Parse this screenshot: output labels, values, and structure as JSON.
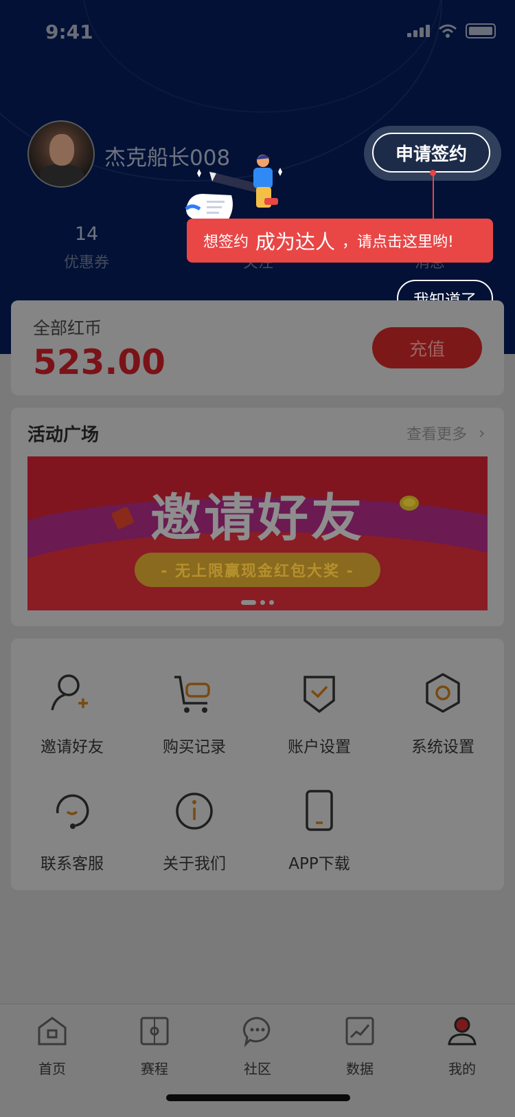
{
  "status_bar": {
    "time": "9:41"
  },
  "profile": {
    "username": "杰克船长008",
    "apply_button": "申请签约"
  },
  "stats": [
    {
      "value": "14",
      "label": "优惠券"
    },
    {
      "value": "",
      "label": "关注"
    },
    {
      "value": "",
      "label": "消息"
    }
  ],
  "tooltip": {
    "prefix": "想签约",
    "highlight": "成为达人",
    "comma": "，",
    "suffix": "请点击这里哟!",
    "dismiss_button": "我知道了"
  },
  "wallet": {
    "title": "全部红币",
    "amount": "523.00",
    "recharge_button": "充值"
  },
  "activity": {
    "title": "活动广场",
    "see_more": "查看更多",
    "banner": {
      "title": "邀请好友",
      "subtitle": "- 无上限赢现金红包大奖 -",
      "dots": 3,
      "active_dot": 0
    }
  },
  "menu": [
    {
      "label": "邀请好友",
      "icon": "invite-friend-icon"
    },
    {
      "label": "购买记录",
      "icon": "cart-icon"
    },
    {
      "label": "账户设置",
      "icon": "shield-check-icon"
    },
    {
      "label": "系统设置",
      "icon": "gear-icon"
    },
    {
      "label": "联系客服",
      "icon": "headset-icon"
    },
    {
      "label": "关于我们",
      "icon": "info-icon"
    },
    {
      "label": "APP下载",
      "icon": "phone-icon"
    }
  ],
  "tabbar": [
    {
      "label": "首页",
      "icon": "home-icon"
    },
    {
      "label": "赛程",
      "icon": "schedule-icon"
    },
    {
      "label": "社区",
      "icon": "chat-bubble-icon"
    },
    {
      "label": "数据",
      "icon": "chart-icon"
    },
    {
      "label": "我的",
      "icon": "user-icon",
      "active": true
    }
  ],
  "colors": {
    "header_bg": "#021135",
    "accent_red": "#e94646",
    "overlay_gray": "#7a7a7a"
  }
}
